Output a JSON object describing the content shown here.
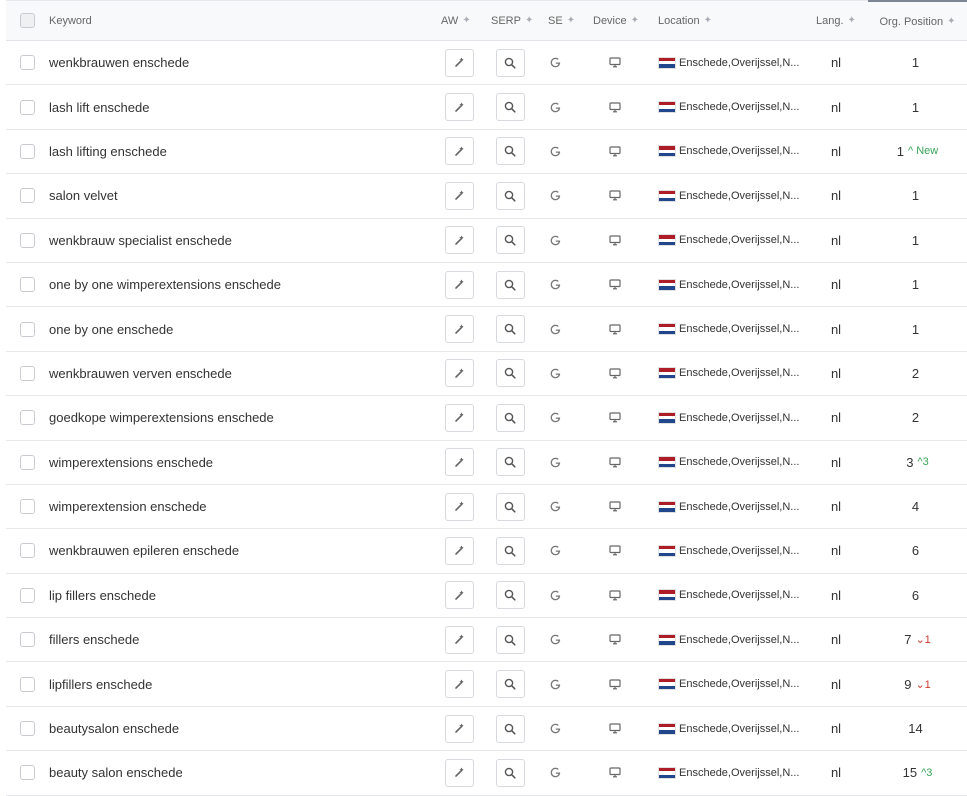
{
  "columns": {
    "keyword": "Keyword",
    "aw": "AW",
    "serp": "SERP",
    "se": "SE",
    "device": "Device",
    "location": "Location",
    "lang": "Lang.",
    "org_position": "Org. Position"
  },
  "icons": {
    "aw": "wand-icon",
    "serp": "search-icon",
    "se": "google-icon",
    "device": "desktop-icon",
    "location_flag": "netherlands-flag-icon"
  },
  "colors": {
    "up": "#3aa55a",
    "down": "#d0382f",
    "flag_red": "#ae1c28",
    "flag_white": "#ffffff",
    "flag_blue": "#21468b"
  },
  "rows": [
    {
      "keyword": "wenkbrauwen enschede",
      "location": "Enschede,Overijssel,N...",
      "lang": "nl",
      "position": "1",
      "change": "",
      "change_dir": ""
    },
    {
      "keyword": "lash lift enschede",
      "location": "Enschede,Overijssel,N...",
      "lang": "nl",
      "position": "1",
      "change": "",
      "change_dir": ""
    },
    {
      "keyword": "lash lifting enschede",
      "location": "Enschede,Overijssel,N...",
      "lang": "nl",
      "position": "1",
      "change": "^ New",
      "change_dir": "up"
    },
    {
      "keyword": "salon velvet",
      "location": "Enschede,Overijssel,N...",
      "lang": "nl",
      "position": "1",
      "change": "",
      "change_dir": ""
    },
    {
      "keyword": "wenkbrauw specialist enschede",
      "location": "Enschede,Overijssel,N...",
      "lang": "nl",
      "position": "1",
      "change": "",
      "change_dir": ""
    },
    {
      "keyword": "one by one wimperextensions enschede",
      "location": "Enschede,Overijssel,N...",
      "lang": "nl",
      "position": "1",
      "change": "",
      "change_dir": ""
    },
    {
      "keyword": "one by one enschede",
      "location": "Enschede,Overijssel,N...",
      "lang": "nl",
      "position": "1",
      "change": "",
      "change_dir": ""
    },
    {
      "keyword": "wenkbrauwen verven enschede",
      "location": "Enschede,Overijssel,N...",
      "lang": "nl",
      "position": "2",
      "change": "",
      "change_dir": ""
    },
    {
      "keyword": "goedkope wimperextensions enschede",
      "location": "Enschede,Overijssel,N...",
      "lang": "nl",
      "position": "2",
      "change": "",
      "change_dir": ""
    },
    {
      "keyword": "wimperextensions enschede",
      "location": "Enschede,Overijssel,N...",
      "lang": "nl",
      "position": "3",
      "change": "^3",
      "change_dir": "up"
    },
    {
      "keyword": "wimperextension enschede",
      "location": "Enschede,Overijssel,N...",
      "lang": "nl",
      "position": "4",
      "change": "",
      "change_dir": ""
    },
    {
      "keyword": "wenkbrauwen epileren enschede",
      "location": "Enschede,Overijssel,N...",
      "lang": "nl",
      "position": "6",
      "change": "",
      "change_dir": ""
    },
    {
      "keyword": "lip fillers enschede",
      "location": "Enschede,Overijssel,N...",
      "lang": "nl",
      "position": "6",
      "change": "",
      "change_dir": ""
    },
    {
      "keyword": "fillers enschede",
      "location": "Enschede,Overijssel,N...",
      "lang": "nl",
      "position": "7",
      "change": "⌄1",
      "change_dir": "down"
    },
    {
      "keyword": "lipfillers enschede",
      "location": "Enschede,Overijssel,N...",
      "lang": "nl",
      "position": "9",
      "change": "⌄1",
      "change_dir": "down"
    },
    {
      "keyword": "beautysalon enschede",
      "location": "Enschede,Overijssel,N...",
      "lang": "nl",
      "position": "14",
      "change": "",
      "change_dir": ""
    },
    {
      "keyword": "beauty salon enschede",
      "location": "Enschede,Overijssel,N...",
      "lang": "nl",
      "position": "15",
      "change": "^3",
      "change_dir": "up"
    }
  ]
}
